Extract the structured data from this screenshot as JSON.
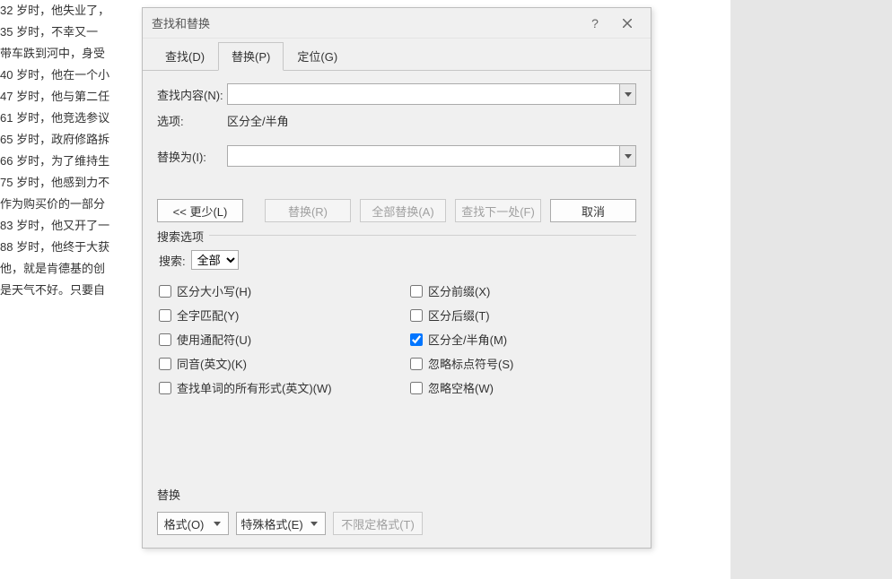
{
  "document": {
    "lines": [
      "32 岁时，他失业了，",
      "35 岁时，不幸又一",
      "带车跌到河中，身受",
      "40 岁时，他在一个小",
      "47 岁时，他与第二任",
      "61 岁时，他竞选参议",
      "65 岁时，政府修路拆",
      "66 岁时，为了维持生",
      "75 岁时，他感到力不",
      "作为购买价的一部分",
      "83 岁时，他又开了一",
      "88 岁时，他终于大获",
      "他，就是肯德基的创",
      "是天气不好。只要自"
    ]
  },
  "dialog": {
    "title": "查找和替换",
    "tabs": {
      "find": "查找(D)",
      "replace": "替换(P)",
      "goto": "定位(G)"
    },
    "labels": {
      "find_what": "查找内容(N):",
      "options": "选项:",
      "options_value": "区分全/半角",
      "replace_with": "替换为(I):"
    },
    "inputs": {
      "find_value": "",
      "replace_value": ""
    },
    "buttons": {
      "less": "<< 更少(L)",
      "replace": "替换(R)",
      "replace_all": "全部替换(A)",
      "find_next": "查找下一处(F)",
      "cancel": "取消"
    },
    "search_options": {
      "legend": "搜索选项",
      "direction_label": "搜索:",
      "direction_value": "全部",
      "left": {
        "match_case": "区分大小写(H)",
        "whole_word": "全字匹配(Y)",
        "wildcards": "使用通配符(U)",
        "sounds_like": "同音(英文)(K)",
        "all_forms": "查找单词的所有形式(英文)(W)"
      },
      "right": {
        "prefix": "区分前缀(X)",
        "suffix": "区分后缀(T)",
        "full_half": "区分全/半角(M)",
        "ignore_punct": "忽略标点符号(S)",
        "ignore_space": "忽略空格(W)"
      },
      "checked": {
        "full_half": true
      }
    },
    "replace_section": {
      "legend": "替换",
      "format": "格式(O)",
      "special": "特殊格式(E)",
      "no_format": "不限定格式(T)"
    }
  }
}
